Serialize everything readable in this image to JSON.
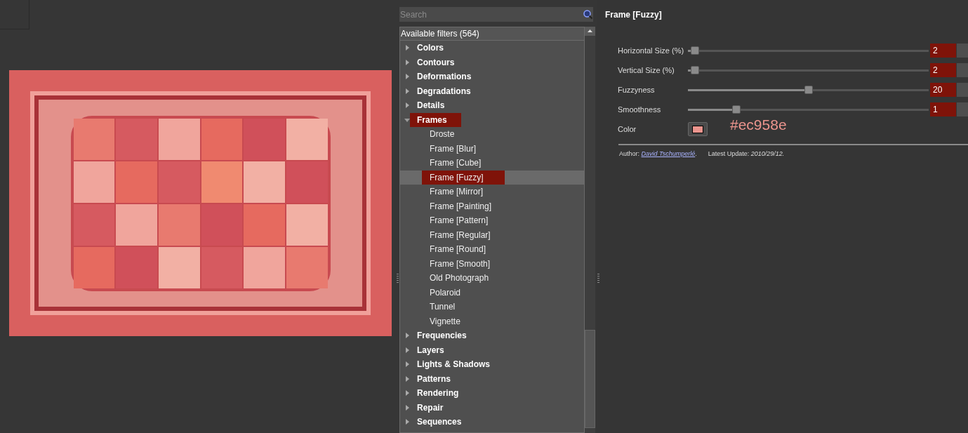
{
  "search": {
    "placeholder": "Search"
  },
  "filters": {
    "header": "Available filters (564)",
    "categories": [
      {
        "label": "Colors",
        "expanded": false,
        "selected": false
      },
      {
        "label": "Contours",
        "expanded": false,
        "selected": false
      },
      {
        "label": "Deformations",
        "expanded": false,
        "selected": false
      },
      {
        "label": "Degradations",
        "expanded": false,
        "selected": false
      },
      {
        "label": "Details",
        "expanded": false,
        "selected": false
      },
      {
        "label": "Frames",
        "expanded": true,
        "selected": true,
        "children": [
          {
            "label": "Droste",
            "selected": false
          },
          {
            "label": "Frame [Blur]",
            "selected": false
          },
          {
            "label": "Frame [Cube]",
            "selected": false
          },
          {
            "label": "Frame [Fuzzy]",
            "selected": true
          },
          {
            "label": "Frame [Mirror]",
            "selected": false
          },
          {
            "label": "Frame [Painting]",
            "selected": false
          },
          {
            "label": "Frame [Pattern]",
            "selected": false
          },
          {
            "label": "Frame [Regular]",
            "selected": false
          },
          {
            "label": "Frame [Round]",
            "selected": false
          },
          {
            "label": "Frame [Smooth]",
            "selected": false
          },
          {
            "label": "Old Photograph",
            "selected": false
          },
          {
            "label": "Polaroid",
            "selected": false
          },
          {
            "label": "Tunnel",
            "selected": false
          },
          {
            "label": "Vignette",
            "selected": false
          }
        ]
      },
      {
        "label": "Frequencies",
        "expanded": false,
        "selected": false
      },
      {
        "label": "Layers",
        "expanded": false,
        "selected": false
      },
      {
        "label": "Lights & Shadows",
        "expanded": false,
        "selected": false
      },
      {
        "label": "Patterns",
        "expanded": false,
        "selected": false
      },
      {
        "label": "Rendering",
        "expanded": false,
        "selected": false
      },
      {
        "label": "Repair",
        "expanded": false,
        "selected": false
      },
      {
        "label": "Sequences",
        "expanded": false,
        "selected": false
      }
    ]
  },
  "filter": {
    "title": "Frame [Fuzzy]",
    "params": [
      {
        "kind": "slider",
        "label": "Horizontal Size (%)",
        "level": 0.03,
        "value": "2"
      },
      {
        "kind": "slider",
        "label": "Vertical Size (%)",
        "level": 0.03,
        "value": "2"
      },
      {
        "kind": "slider",
        "label": "Fuzzyness",
        "level": 0.5,
        "value": "20"
      },
      {
        "kind": "slider",
        "label": "Smoothness",
        "level": 0.2,
        "value": "1"
      },
      {
        "kind": "color",
        "label": "Color",
        "color": "#ec958e",
        "annotation": "#ec958e"
      }
    ],
    "author": {
      "label": "Author:",
      "name": "David Tschumperlé",
      "suffix": "."
    },
    "update": "Latest Update: *2010/29/12.*"
  }
}
